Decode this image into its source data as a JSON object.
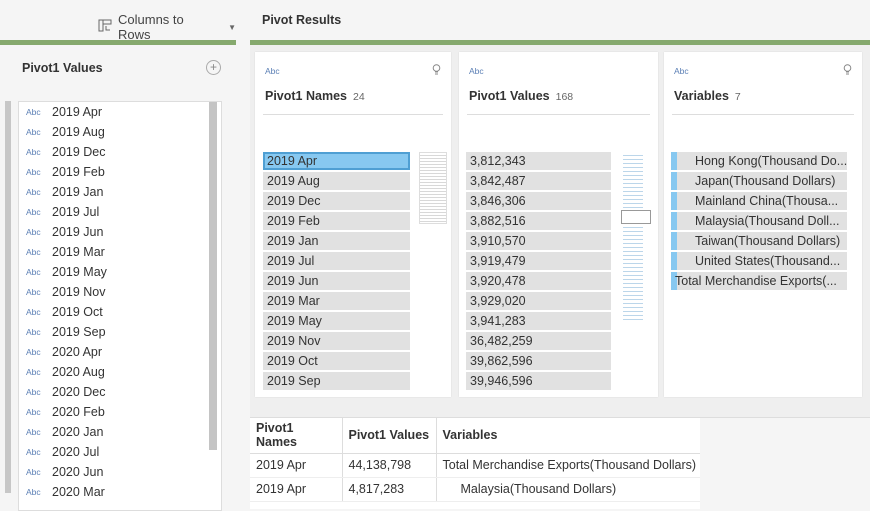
{
  "toolbar": {
    "pivot_label": "Columns to Rows"
  },
  "left_panel": {
    "header": "Pivot1 Values",
    "fields": [
      "2019 Apr",
      "2019 Aug",
      "2019 Dec",
      "2019 Feb",
      "2019 Jan",
      "2019 Jul",
      "2019 Jun",
      "2019 Mar",
      "2019 May",
      "2019 Nov",
      "2019 Oct",
      "2019 Sep",
      "2020 Apr",
      "2020 Aug",
      "2020 Dec",
      "2020 Feb",
      "2020 Jan",
      "2020 Jul",
      "2020 Jun",
      "2020 Mar"
    ],
    "type_label": "Abc"
  },
  "results": {
    "title": "Pivot Results",
    "cards": [
      {
        "type_label": "Abc",
        "name": "Pivot1 Names",
        "count": "24",
        "values": [
          "2019 Apr",
          "2019 Aug",
          "2019 Dec",
          "2019 Feb",
          "2019 Jan",
          "2019 Jul",
          "2019 Jun",
          "2019 Mar",
          "2019 May",
          "2019 Nov",
          "2019 Oct",
          "2019 Sep"
        ]
      },
      {
        "type_label": "Abc",
        "name": "Pivot1 Values",
        "count": "168",
        "values": [
          "3,812,343",
          "3,842,487",
          "3,846,306",
          "3,882,516",
          "3,910,570",
          "3,919,479",
          "3,920,478",
          "3,929,020",
          "3,941,283",
          "36,482,259",
          "39,862,596",
          "39,946,596"
        ]
      },
      {
        "type_label": "Abc",
        "name": "Variables",
        "count": "7",
        "values": [
          "Hong Kong(Thousand Do...",
          "Japan(Thousand Dollars)",
          "Mainland China(Thousa...",
          "Malaysia(Thousand Doll...",
          "Taiwan(Thousand Dollars)",
          "United States(Thousand...",
          "Total Merchandise Exports(..."
        ]
      }
    ]
  },
  "grid": {
    "headers": [
      "Pivot1 Names",
      "Pivot1 Values",
      "Variables"
    ],
    "rows": [
      [
        "2019 Apr",
        "44,138,798",
        "Total Merchandise Exports(Thousand Dollars)"
      ],
      [
        "2019 Apr",
        "4,817,283",
        "Malaysia(Thousand Dollars)"
      ]
    ]
  }
}
